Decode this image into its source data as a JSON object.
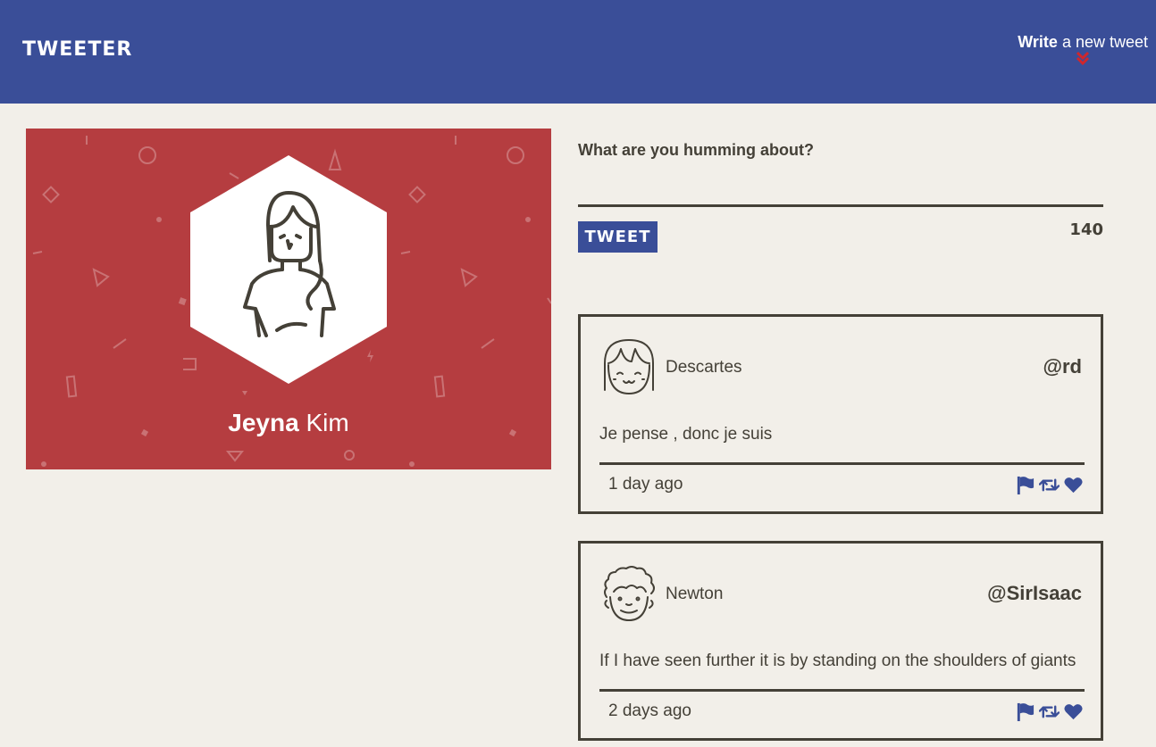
{
  "header": {
    "logo": "TWEETER",
    "compose_toggle": {
      "strong": "Write",
      "rest": "a new tweet"
    }
  },
  "profile": {
    "first_name": "Jeyna",
    "last_name": "Kim",
    "avatar_icon": "woman-avatar-icon",
    "background_color": "#b53d40"
  },
  "compose": {
    "label": "What are you humming about?",
    "input_value": "",
    "button_label": "TWEET",
    "counter": "140"
  },
  "tweets": [
    {
      "author": "Descartes",
      "handle": "@rd",
      "body": "Je pense , donc je suis",
      "time": "1 day ago",
      "avatar_icon": "girl-avatar-icon",
      "actions": [
        "flag-icon",
        "retweet-icon",
        "heart-icon"
      ]
    },
    {
      "author": "Newton",
      "handle": "@SirIsaac",
      "body": "If I have seen further it is by standing on the shoulders of giants",
      "time": "2 days ago",
      "avatar_icon": "curly-hair-avatar-icon",
      "actions": [
        "flag-icon",
        "retweet-icon",
        "heart-icon"
      ]
    }
  ],
  "colors": {
    "header": "#3a4e98",
    "accent_red": "#b53d40",
    "text_dark": "#444037",
    "page_bg": "#f2efe9",
    "chevron": "#d0262b"
  }
}
